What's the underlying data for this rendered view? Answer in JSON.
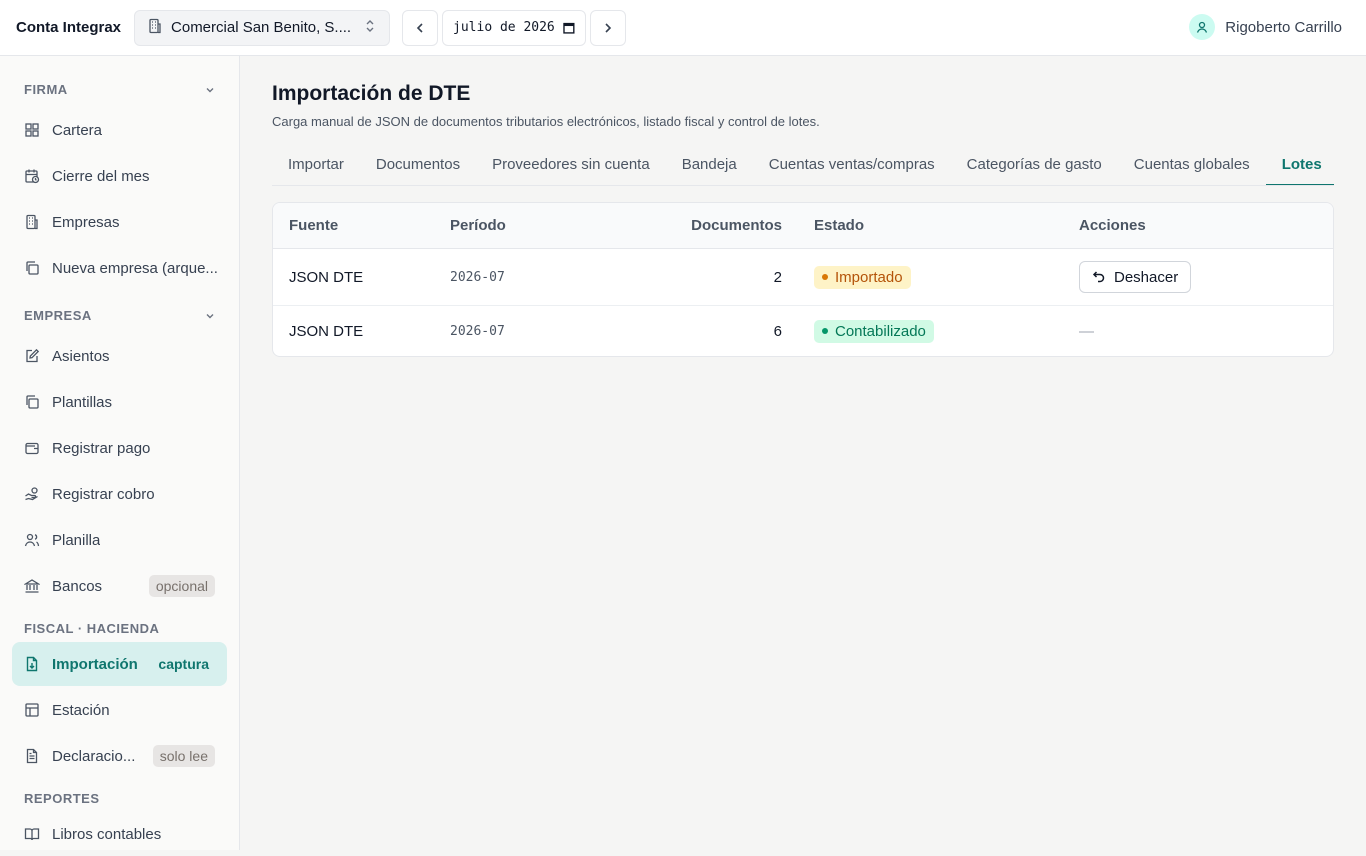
{
  "header": {
    "brand": "Conta Integrax",
    "company": "Comercial San Benito, S....",
    "period_value": "julio de 2026",
    "user_name": "Rigoberto Carrillo"
  },
  "sidebar": {
    "sections": [
      {
        "title": "FIRMA",
        "items": [
          {
            "label": "Cartera",
            "icon": "grid-icon"
          },
          {
            "label": "Cierre del mes",
            "icon": "calendar-clock-icon"
          },
          {
            "label": "Empresas",
            "icon": "building-icon"
          },
          {
            "label": "Nueva empresa (arque...",
            "icon": "copy-plus-icon"
          }
        ]
      },
      {
        "title": "EMPRESA",
        "items": [
          {
            "label": "Asientos",
            "icon": "edit-icon"
          },
          {
            "label": "Plantillas",
            "icon": "copy-icon"
          },
          {
            "label": "Registrar pago",
            "icon": "wallet-icon"
          },
          {
            "label": "Registrar cobro",
            "icon": "hand-coins-icon"
          },
          {
            "label": "Planilla",
            "icon": "users-icon"
          },
          {
            "label": "Bancos",
            "icon": "bank-icon",
            "tag": "opcional"
          }
        ]
      },
      {
        "title": "FISCAL · HACIENDA",
        "items": [
          {
            "label": "Importación",
            "icon": "file-import-icon",
            "tag": "captura",
            "active": true
          },
          {
            "label": "Estación",
            "icon": "table-icon"
          },
          {
            "label": "Declaracio...",
            "icon": "file-text-icon",
            "tag": "solo lee"
          }
        ]
      },
      {
        "title": "REPORTES",
        "items": [
          {
            "label": "Libros contables",
            "icon": "book-icon"
          }
        ]
      }
    ]
  },
  "main": {
    "title": "Importación de DTE",
    "subtitle": "Carga manual de JSON de documentos tributarios electrónicos, listado fiscal y control de lotes.",
    "tabs": [
      "Importar",
      "Documentos",
      "Proveedores sin cuenta",
      "Bandeja",
      "Cuentas ventas/compras",
      "Categorías de gasto",
      "Cuentas globales",
      "Lotes"
    ],
    "active_tab": "Lotes",
    "table": {
      "headers": [
        "Fuente",
        "Período",
        "Documentos",
        "Estado",
        "Acciones"
      ],
      "rows": [
        {
          "fuente": "JSON DTE",
          "periodo": "2026-07",
          "documentos": "2",
          "estado": "Importado",
          "estado_color": "#b45309",
          "accion": "Deshacer"
        },
        {
          "fuente": "JSON DTE",
          "periodo": "2026-07",
          "documentos": "6",
          "estado": "Contabilizado",
          "estado_color": "#047857",
          "accion": "—"
        }
      ]
    }
  },
  "colors": {
    "accent": "#0f766e",
    "active_bg": "#d7f0ee"
  }
}
